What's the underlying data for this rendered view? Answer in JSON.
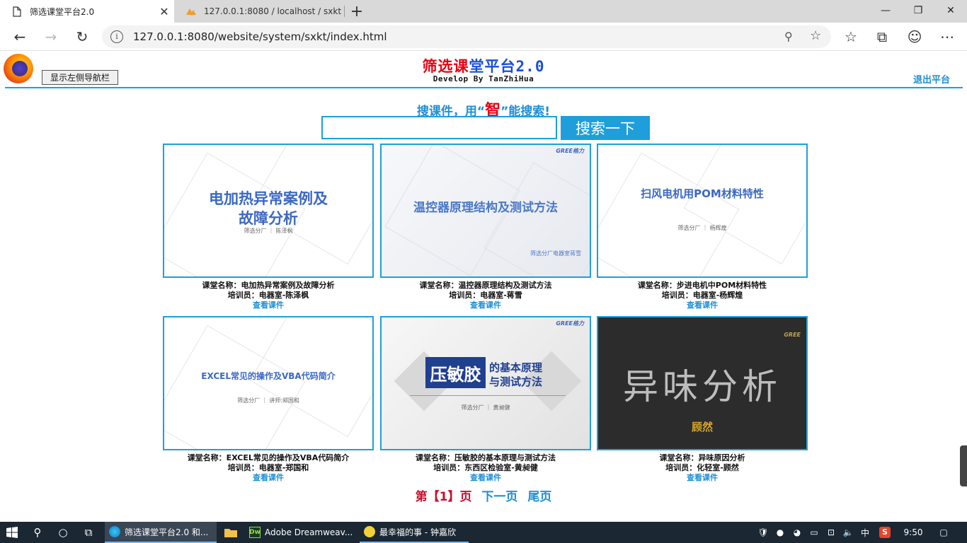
{
  "browser": {
    "tabs": [
      {
        "title": "筛选课堂平台2.0",
        "active": true
      },
      {
        "title": "127.0.0.1:8080 / localhost / sxkt / ",
        "active": false
      }
    ],
    "url": "127.0.0.1:8080/website/system/sxkt/index.html"
  },
  "header": {
    "brand_1": "筛选",
    "brand_2": "课",
    "brand_3": "堂平台",
    "brand_4": "2.0",
    "subtitle": "Develop By TanZhiHua",
    "show_nav_label": "显示左侧导航栏",
    "logout_label": "退出平台"
  },
  "search": {
    "slogan_before": "搜课件，用“",
    "slogan_highlight": "智",
    "slogan_after": "”能搜索!",
    "value": "",
    "button_label": "搜索一下"
  },
  "courses": [
    {
      "name": "课堂名称：电加热异常案例及故障分析",
      "trainer": "培训员：电器室-陈泽枫",
      "link": "查看课件",
      "thumb_title_1": "电加热异常案例及",
      "thumb_title_2": "故障分析",
      "thumb_sub": "筛选分厂 ｜ 陈泽枫"
    },
    {
      "name": "课堂名称：温控器原理结构及测试方法",
      "trainer": "培训员：电器室-蒋雪",
      "link": "查看课件",
      "thumb_title_1": "温控器原理结构及测试方法",
      "thumb_sub": "筛选分厂电器室蒋雪",
      "thumb_logo": "GREE格力"
    },
    {
      "name": "课堂名称：步进电机中POM材料特性",
      "trainer": "培训员：电器室-杨辉煌",
      "link": "查看课件",
      "thumb_title_1": "扫风电机用POM材料特性",
      "thumb_sub": "筛选分厂 ｜ 杨辉煌"
    },
    {
      "name": "课堂名称：EXCEL常见的操作及VBA代码简介",
      "trainer": "培训员：电器室-郑国和",
      "link": "查看课件",
      "thumb_title_1": "EXCEL常见的操作及VBA代码简介",
      "thumb_sub": "筛选分厂 ｜ 讲师:郑国和"
    },
    {
      "name": "课堂名称：压敏胶的基本原理与测试方法",
      "trainer": "培训员：东西区检验室-黄昶健",
      "link": "查看课件",
      "thumb_box": "压敏胶",
      "thumb_title_1": "的基本原理",
      "thumb_title_2": "与测试方法",
      "thumb_sub": "筛选分厂 ｜ 黄昶健",
      "thumb_logo": "GREE格力"
    },
    {
      "name": "课堂名称：异味原因分析",
      "trainer": "培训员：化轻室-顾然",
      "link": "查看课件",
      "thumb_title_1": "异味分析",
      "thumb_sub": "顾然",
      "thumb_logo": "GREE"
    }
  ],
  "pager": {
    "current": "第【1】页",
    "next": "下一页",
    "last": "尾页"
  },
  "taskbar": {
    "tasks": [
      "筛选课堂平台2.0 和...",
      "Adobe Dreamweav...",
      "最幸福的事 - 钟嘉欣"
    ],
    "ime": "中",
    "time": "9:50"
  }
}
